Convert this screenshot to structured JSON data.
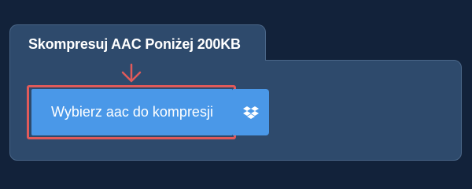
{
  "panel": {
    "title": "Skompresuj AAC Poniżej 200KB"
  },
  "actions": {
    "select_file_label": "Wybierz aac do kompresji",
    "dropbox_icon": "dropbox-icon",
    "arrow_icon": "arrow-down-icon"
  },
  "colors": {
    "background": "#12223a",
    "panel": "#2e4a6c",
    "button": "#4a98e8",
    "highlight": "#e05a5a"
  }
}
